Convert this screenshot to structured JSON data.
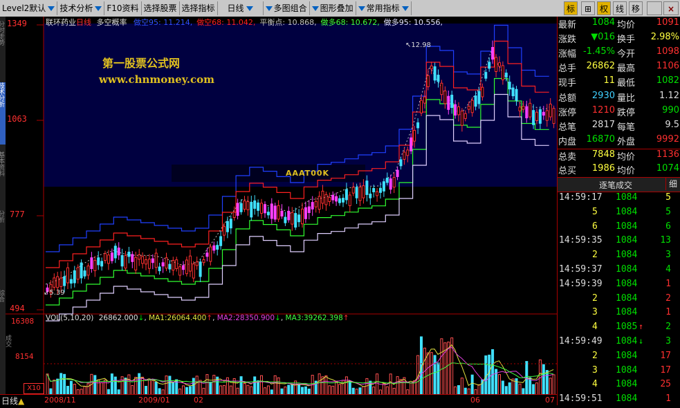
{
  "toolbar": {
    "items": [
      "Level2默认",
      "技术分析",
      "F10资料",
      "选择股票",
      "选择指标",
      "日线",
      "多图组合",
      "图形叠加",
      "常用指标"
    ],
    "right": [
      "标",
      "⊞",
      "权",
      "线",
      "移"
    ],
    "right_close": "×"
  },
  "left_tabs": [
    "分时走势",
    "技术分析",
    "基本资料",
    "分析",
    "综合"
  ],
  "chart": {
    "stock_name": "联环药业",
    "period": "日线",
    "indicator_name": "多空概率",
    "legend": [
      {
        "label": "做空95:",
        "value": "11.214,",
        "color": "#3050ff"
      },
      {
        "label": "做空68:",
        "value": "11.042,",
        "color": "#ff2020"
      },
      {
        "label": "平衡点:",
        "value": "10.868,",
        "color": "#c0c0c0"
      },
      {
        "label": "做多68:",
        "value": "10.672,",
        "color": "#40ff40"
      },
      {
        "label": "做多95:",
        "value": "10.556,",
        "color": "#e0e0ff"
      }
    ],
    "y_labels": [
      "1349",
      "1063",
      "777",
      "494"
    ],
    "watermark_line1": "第一股票公式网",
    "watermark_line2": "www.chnmoney.com",
    "annot_high": "12.98",
    "annot_low": "5.39",
    "overlay_text": "AAAT00K"
  },
  "volume": {
    "label": "VOL(5,10,20)",
    "value": "26862.000",
    "ma1_label": "MA1:",
    "ma1": "26064.400",
    "ma2_label": "MA2:",
    "ma2": "28350.900",
    "ma3_label": "MA3:",
    "ma3": "39262.398",
    "y_labels": [
      "16308",
      "8154"
    ],
    "scale": "X10",
    "side_label": "成交"
  },
  "xaxis": {
    "period_button": "日线",
    "labels": [
      "2008/11",
      "2009/01",
      "02",
      "06",
      "07"
    ]
  },
  "quote": {
    "rows": [
      {
        "k1": "最新",
        "v1": "1084",
        "c1": "#00e000",
        "k2": "均价",
        "v2": "1091",
        "c2": "#ff3030"
      },
      {
        "k1": "涨跌",
        "v1": "▼016",
        "c1": "#00e000",
        "k2": "换手",
        "v2": "2.98%",
        "c2": "#ffff40"
      },
      {
        "k1": "涨幅",
        "v1": "-1.45%",
        "c1": "#00e000",
        "k2": "今开",
        "v2": "1098",
        "c2": "#ff3030"
      },
      {
        "k1": "总手",
        "v1": "26862",
        "c1": "#ffff40",
        "k2": "最高",
        "v2": "1106",
        "c2": "#ff3030"
      },
      {
        "k1": "现手",
        "v1": "11",
        "c1": "#ffff40",
        "k2": "最低",
        "v2": "1082",
        "c2": "#00e000"
      },
      {
        "k1": "总额",
        "v1": "2930",
        "c1": "#40d0ff",
        "k2": "量比",
        "v2": "1.12",
        "c2": "#dddddd"
      },
      {
        "k1": "涨停",
        "v1": "1210",
        "c1": "#ff3030",
        "k2": "跌停",
        "v2": "990",
        "c2": "#00e000"
      },
      {
        "k1": "总笔",
        "v1": "2817",
        "c1": "#dddddd",
        "k2": "每笔",
        "v2": "9.5",
        "c2": "#dddddd"
      },
      {
        "k1": "内盘",
        "v1": "16870",
        "c1": "#00e000",
        "k2": "外盘",
        "v2": "9992",
        "c2": "#ff3030"
      },
      {
        "k1": "总卖",
        "v1": "7848",
        "c1": "#ffff40",
        "k2": "均价",
        "v2": "1136",
        "c2": "#ff3030"
      },
      {
        "k1": "总买",
        "v1": "1986",
        "c1": "#ffff40",
        "k2": "均价",
        "v2": "1074",
        "c2": "#00e000"
      }
    ]
  },
  "trades": {
    "title": "逐笔成交",
    "detail_btn": "细",
    "rows": [
      {
        "time": "14:59:17",
        "price": "1084",
        "vol": "5",
        "vc": "#ffff40",
        "arrow": ""
      },
      {
        "time": "",
        "price": "1084",
        "vol": "5",
        "vc": "#00e000",
        "arrow": "",
        "lvol": "5"
      },
      {
        "time": "",
        "price": "1084",
        "vol": "6",
        "vc": "#00e000",
        "arrow": "",
        "lvol": "6"
      },
      {
        "time": "14:59:35",
        "price": "1084",
        "vol": "13",
        "vc": "#00e000",
        "arrow": ""
      },
      {
        "time": "",
        "price": "1084",
        "vol": "3",
        "vc": "#00e000",
        "arrow": "",
        "lvol": "2"
      },
      {
        "time": "14:59:37",
        "price": "1084",
        "vol": "4",
        "vc": "#00e000",
        "arrow": ""
      },
      {
        "time": "14:59:39",
        "price": "1084",
        "vol": "1",
        "vc": "#ff3030",
        "arrow": ""
      },
      {
        "time": "",
        "price": "1084",
        "vol": "2",
        "vc": "#ff3030",
        "arrow": "",
        "lvol": "2"
      },
      {
        "time": "",
        "price": "1084",
        "vol": "1",
        "vc": "#ff3030",
        "arrow": "",
        "lvol": "3"
      },
      {
        "time": "",
        "price": "1085",
        "vol": "2",
        "vc": "#00e000",
        "arrow": "up",
        "lvol": "4"
      },
      {
        "time": "14:59:49",
        "price": "1084",
        "vol": "3",
        "vc": "#00e000",
        "arrow": "down"
      },
      {
        "time": "",
        "price": "1084",
        "vol": "17",
        "vc": "#ff3030",
        "arrow": "",
        "lvol": "2"
      },
      {
        "time": "",
        "price": "1084",
        "vol": "17",
        "vc": "#ff3030",
        "arrow": "",
        "lvol": "3"
      },
      {
        "time": "",
        "price": "1084",
        "vol": "25",
        "vc": "#ff3030",
        "arrow": "",
        "lvol": "4"
      },
      {
        "time": "14:59:51",
        "price": "1084",
        "vol": "1",
        "vc": "#ff3030",
        "arrow": ""
      }
    ]
  }
}
